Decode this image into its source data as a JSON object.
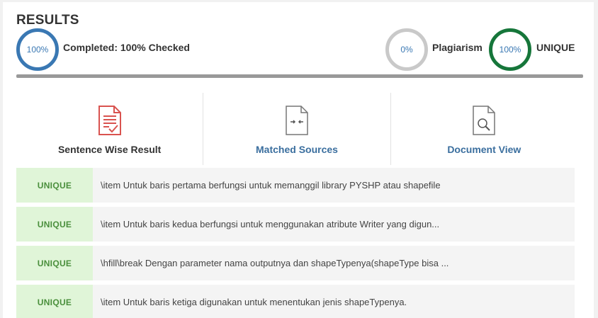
{
  "results": {
    "title": "RESULTS",
    "completed": {
      "ring_text": "100%",
      "label": "Completed: 100% Checked"
    },
    "plagiarism": {
      "ring_text": "0%",
      "label": "Plagiarism"
    },
    "unique": {
      "ring_text": "100%",
      "label": "UNIQUE"
    }
  },
  "tabs": [
    {
      "label": "Sentence Wise Result",
      "icon": "document-check-icon"
    },
    {
      "label": "Matched Sources",
      "icon": "document-compare-icon"
    },
    {
      "label": "Document View",
      "icon": "document-search-icon"
    }
  ],
  "rows": [
    {
      "badge": "UNIQUE",
      "text": "\\item Untuk baris pertama berfungsi untuk memanggil library PYSHP atau shapefile"
    },
    {
      "badge": "UNIQUE",
      "text": "\\item Untuk baris kedua berfungsi untuk menggunakan atribute Writer yang digun..."
    },
    {
      "badge": "UNIQUE",
      "text": "\\hfill\\break Dengan parameter nama outputnya dan shapeTypenya(shapeType bisa ..."
    },
    {
      "badge": "UNIQUE",
      "text": "\\item Untuk baris ketiga digunakan untuk menentukan jenis shapeTypenya."
    }
  ],
  "colors": {
    "accent_blue": "#3a78b3",
    "unique_green": "#16763a",
    "plagiarism_grey": "#c9c9c9",
    "badge_bg": "#e0f5d8",
    "icon_red": "#d9534f"
  }
}
